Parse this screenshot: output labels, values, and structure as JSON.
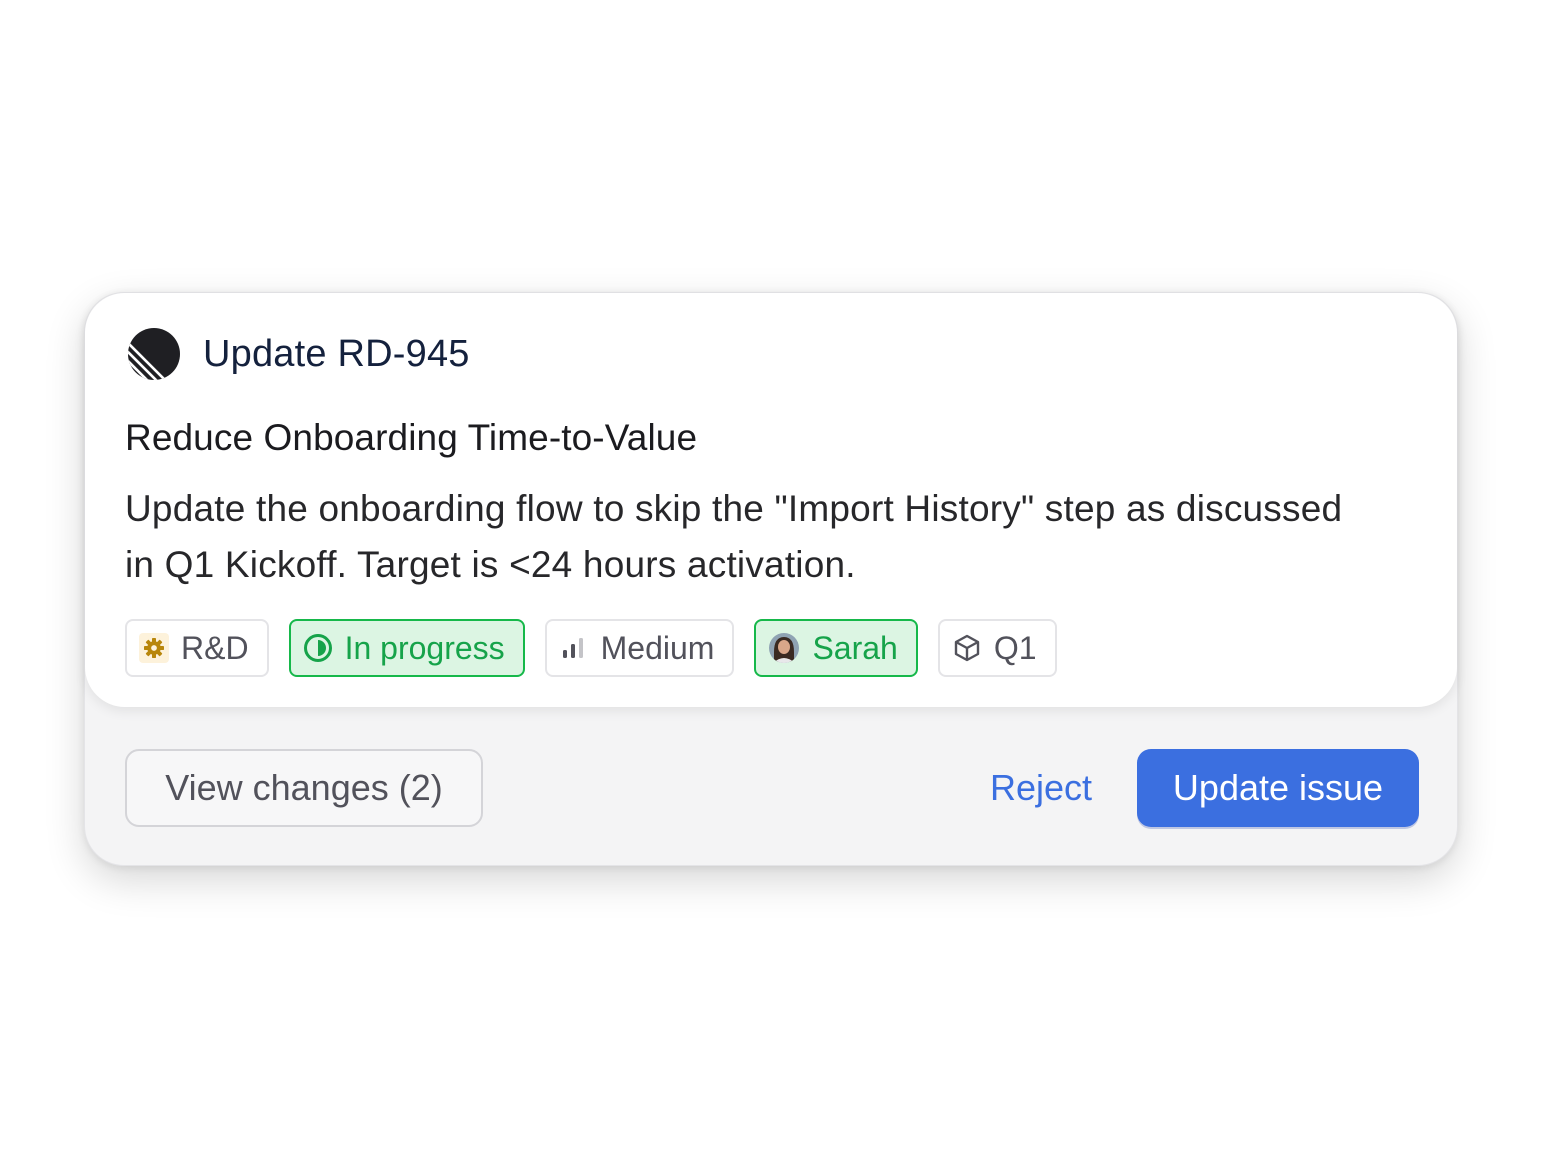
{
  "header": {
    "title": "Update RD-945",
    "logo_icon": "linear-logo-icon"
  },
  "issue": {
    "title": "Reduce Onboarding Time-to-Value",
    "description": "Update the onboarding flow to skip the \"Import History\" step as discussed in Q1 Kickoff. Target is <24 hours activation."
  },
  "chips": {
    "team": {
      "label": "R&D",
      "icon": "gear-icon",
      "color": "#b8860b"
    },
    "status": {
      "label": "In progress",
      "icon": "half-circle-status-icon",
      "color": "#16a34a"
    },
    "priority": {
      "label": "Medium",
      "icon": "signal-bars-icon"
    },
    "assignee": {
      "label": "Sarah",
      "icon": "avatar"
    },
    "cycle": {
      "label": "Q1",
      "icon": "cube-icon"
    }
  },
  "footer": {
    "view_changes_label": "View changes (2)",
    "reject_label": "Reject",
    "update_label": "Update issue"
  },
  "colors": {
    "accent": "#3b6fe0",
    "success": "#16a34a",
    "card_bg": "#f4f4f5"
  }
}
